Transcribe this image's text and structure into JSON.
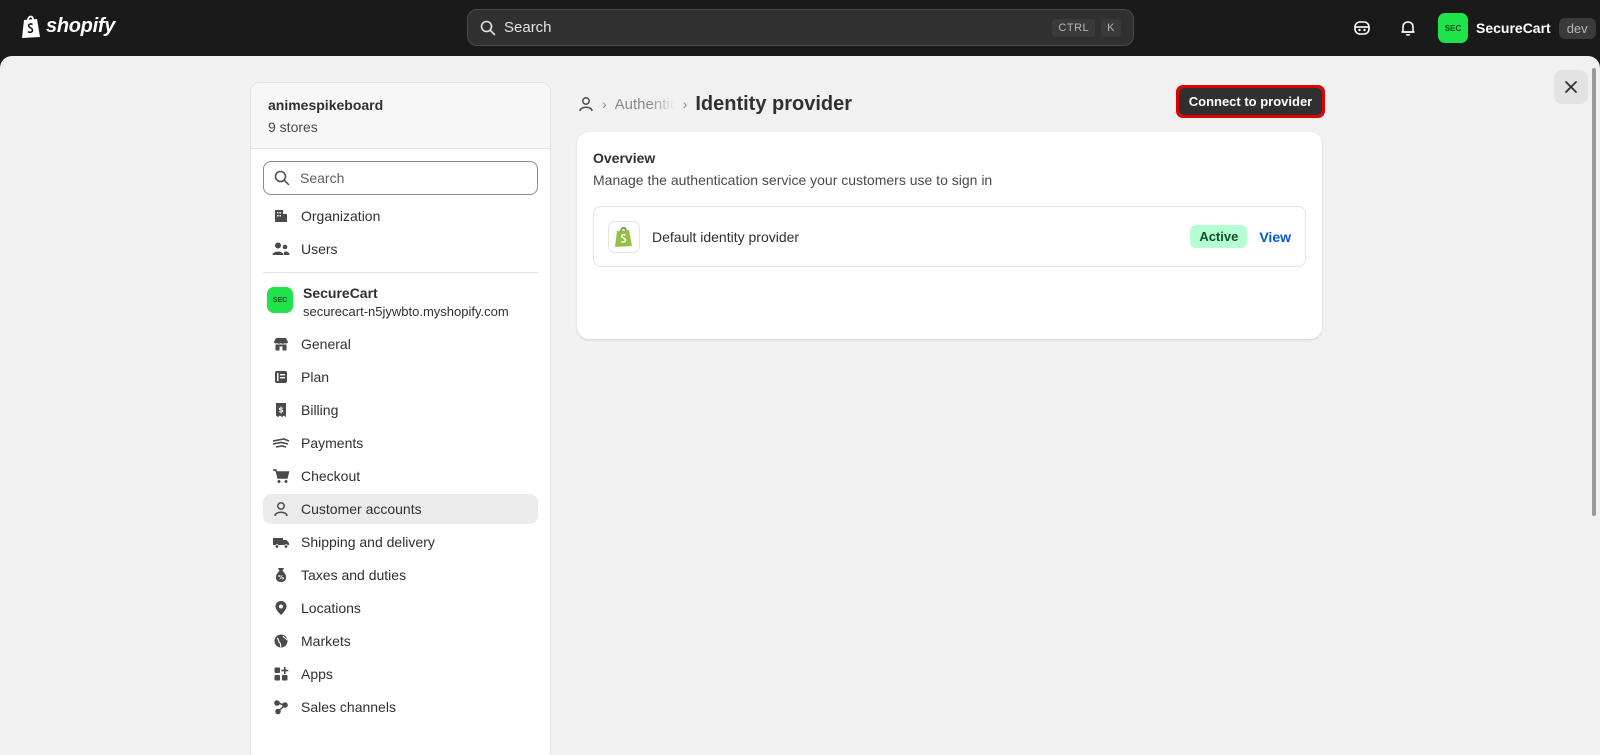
{
  "topbar": {
    "brand": "shopify",
    "search_placeholder": "Search",
    "shortcut_keys": [
      "CTRL",
      "K"
    ],
    "store_avatar": "SEC",
    "store_name": "SecureCart",
    "env_badge": "dev"
  },
  "sidebar": {
    "org_name": "animespikeboard",
    "org_stores": "9 stores",
    "search_placeholder": "Search",
    "org_items": [
      {
        "label": "Organization",
        "icon": "building-icon"
      },
      {
        "label": "Users",
        "icon": "users-icon"
      }
    ],
    "store": {
      "avatar": "SEC",
      "name": "SecureCart",
      "domain": "securecart-n5jywbto.myshopify.com"
    },
    "store_items": [
      {
        "label": "General",
        "icon": "store-icon"
      },
      {
        "label": "Plan",
        "icon": "plan-icon"
      },
      {
        "label": "Billing",
        "icon": "billing-icon"
      },
      {
        "label": "Payments",
        "icon": "payments-icon"
      },
      {
        "label": "Checkout",
        "icon": "cart-icon"
      },
      {
        "label": "Customer accounts",
        "icon": "person-icon",
        "active": true
      },
      {
        "label": "Shipping and delivery",
        "icon": "truck-icon"
      },
      {
        "label": "Taxes and duties",
        "icon": "tax-icon"
      },
      {
        "label": "Locations",
        "icon": "location-icon"
      },
      {
        "label": "Markets",
        "icon": "globe-icon"
      },
      {
        "label": "Apps",
        "icon": "apps-icon"
      },
      {
        "label": "Sales channels",
        "icon": "channels-icon"
      }
    ]
  },
  "main": {
    "breadcrumb_parent": "Authentication",
    "title": "Identity provider",
    "primary_action": "Connect to provider",
    "overview": {
      "title": "Overview",
      "subtitle": "Manage the authentication service your customers use to sign in",
      "provider_name": "Default identity provider",
      "status": "Active",
      "view_label": "View"
    }
  },
  "colors": {
    "accent_green": "#1ee34a",
    "active_badge_bg": "#b4fed2",
    "link_blue": "#005bd3",
    "highlight_red": "#e00000"
  }
}
